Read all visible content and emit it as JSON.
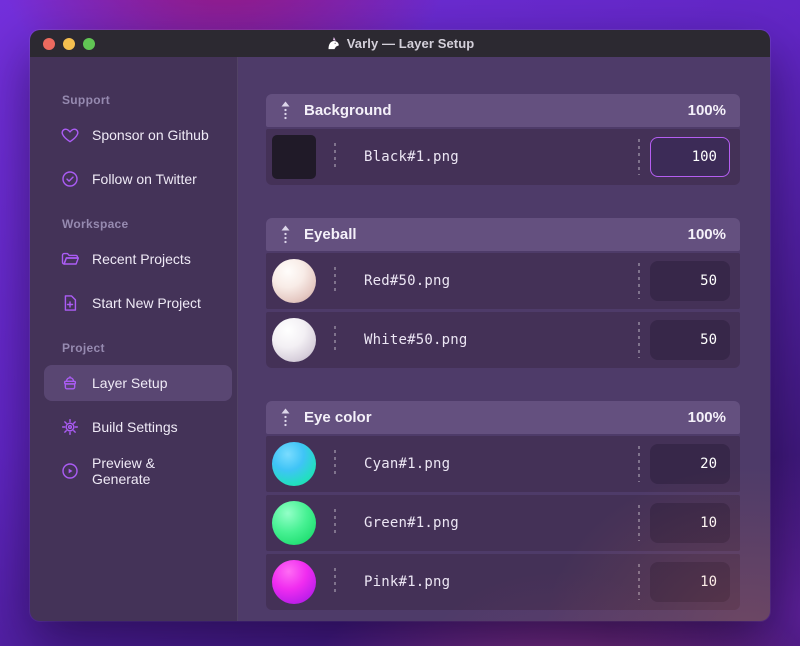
{
  "window": {
    "title": "Varly — Layer Setup",
    "traffic_lights": [
      {
        "name": "close",
        "color": "#ed6a5f"
      },
      {
        "name": "minimize",
        "color": "#f5bf4f"
      },
      {
        "name": "zoom",
        "color": "#61c554"
      }
    ]
  },
  "colors": {
    "accent_purple": "#ab5cf5",
    "focus_border": "#b55ef2",
    "sidebar_bg": "#443358",
    "main_bg": "#4e3b69",
    "group_header_bg": "#64507f",
    "row_bg": "#443157"
  },
  "sidebar": {
    "sections": [
      {
        "label": "Support",
        "items": [
          {
            "icon": "heart-icon",
            "label": "Sponsor on Github",
            "active": false
          },
          {
            "icon": "badge-check-icon",
            "label": "Follow on Twitter",
            "active": false
          }
        ]
      },
      {
        "label": "Workspace",
        "items": [
          {
            "icon": "folder-icon",
            "label": "Recent Projects",
            "active": false
          },
          {
            "icon": "file-plus-icon",
            "label": "Start New Project",
            "active": false
          }
        ]
      },
      {
        "label": "Project",
        "items": [
          {
            "icon": "layers-icon",
            "label": "Layer Setup",
            "active": true
          },
          {
            "icon": "gear-icon",
            "label": "Build Settings",
            "active": false
          },
          {
            "icon": "play-circle-icon",
            "label": "Preview & Generate",
            "active": false
          }
        ]
      }
    ]
  },
  "layers": {
    "groups": [
      {
        "name": "Background",
        "weight": "100%",
        "rows": [
          {
            "thumb": "black-square",
            "file": "Black#1.png",
            "value": "100",
            "focused": true
          }
        ]
      },
      {
        "name": "Eyeball",
        "weight": "100%",
        "rows": [
          {
            "thumb": "red-sphere",
            "file": "Red#50.png",
            "value": "50",
            "focused": false
          },
          {
            "thumb": "white-sphere",
            "file": "White#50.png",
            "value": "50",
            "focused": false
          }
        ]
      },
      {
        "name": "Eye color",
        "weight": "100%",
        "rows": [
          {
            "thumb": "cyan-sphere",
            "file": "Cyan#1.png",
            "value": "20",
            "focused": false
          },
          {
            "thumb": "green-sphere",
            "file": "Green#1.png",
            "value": "10",
            "focused": false
          },
          {
            "thumb": "pink-sphere",
            "file": "Pink#1.png",
            "value": "10",
            "focused": false
          }
        ]
      }
    ]
  }
}
